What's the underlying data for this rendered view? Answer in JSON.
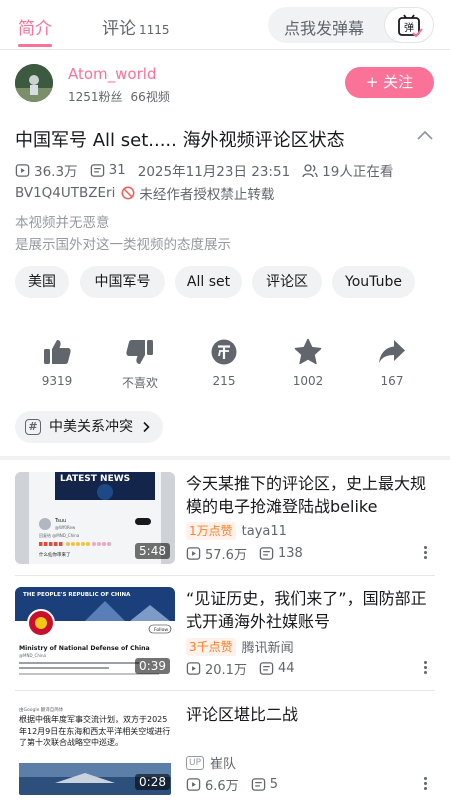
{
  "tabs": {
    "intro": "简介",
    "comments": "评论",
    "comments_count": "1115"
  },
  "danmu": {
    "placeholder": "点我发弹幕",
    "button": "弹"
  },
  "uploader": {
    "name": "Atom_world",
    "fans": "1251粉丝",
    "videos": "66视频",
    "follow_label": "+ 关注"
  },
  "video": {
    "title": "中国军号 All set..... 海外视频评论区状态",
    "plays": "36.3万",
    "danmaku": "31",
    "datetime": "2025年11月23日 23:51",
    "watching": "19人正在看",
    "bvid": "BV1Q4UTBZEri",
    "copyright": "未经作者授权禁止转载",
    "desc_line1": "本视频并无恶意",
    "desc_line2": "是展示国外对这一类视频的态度展示"
  },
  "tags": [
    "美国",
    "中国军号",
    "All set",
    "评论区",
    "YouTube"
  ],
  "actions": {
    "like": "9319",
    "dislike": "不喜欢",
    "coin": "215",
    "favorite": "1002",
    "share": "167"
  },
  "topic": "中美关系冲突",
  "related": [
    {
      "title": "今天某推下的评论区，史上最大规模的电子抢滩登陆战belike",
      "hot": "1万点赞",
      "author": "taya11",
      "plays": "57.6万",
      "danmaku": "138",
      "duration": "5:48",
      "thumb_text": "LATEST NEWS",
      "thumb_user": "Tsuu",
      "thumb_handle": "@Wf0Rew",
      "thumb_reply": "回复给 @MND_China",
      "thumb_comment": "什么仙你审来了"
    },
    {
      "title": "“见证历史，我们来了”，国防部正式开通海外社媒账号",
      "hot": "3千点赞",
      "author": "腾讯新闻",
      "plays": "20.1万",
      "danmaku": "44",
      "duration": "0:39",
      "thumb_banner": "THE PEOPLE'S REPUBLIC OF CHINA",
      "thumb_name": "Ministry of National Defense of China",
      "thumb_handle": "@MND_China",
      "thumb_follow": "Follow"
    },
    {
      "title": "评论区堪比二战",
      "author": "崔队",
      "plays": "6.6万",
      "danmaku": "5",
      "duration": "0:28",
      "thumb_header": "由Google 翻译自简体",
      "thumb_body": "根据中俄年度军事交流计划，双方于2025年12月9日在东海和西太平洋相关空域进行了第十次联合战略空中巡逻。"
    }
  ],
  "colors": {
    "accent": "#fb7299",
    "text": "#18191c",
    "secondary": "#61666d",
    "hot": "#ff7f24"
  }
}
